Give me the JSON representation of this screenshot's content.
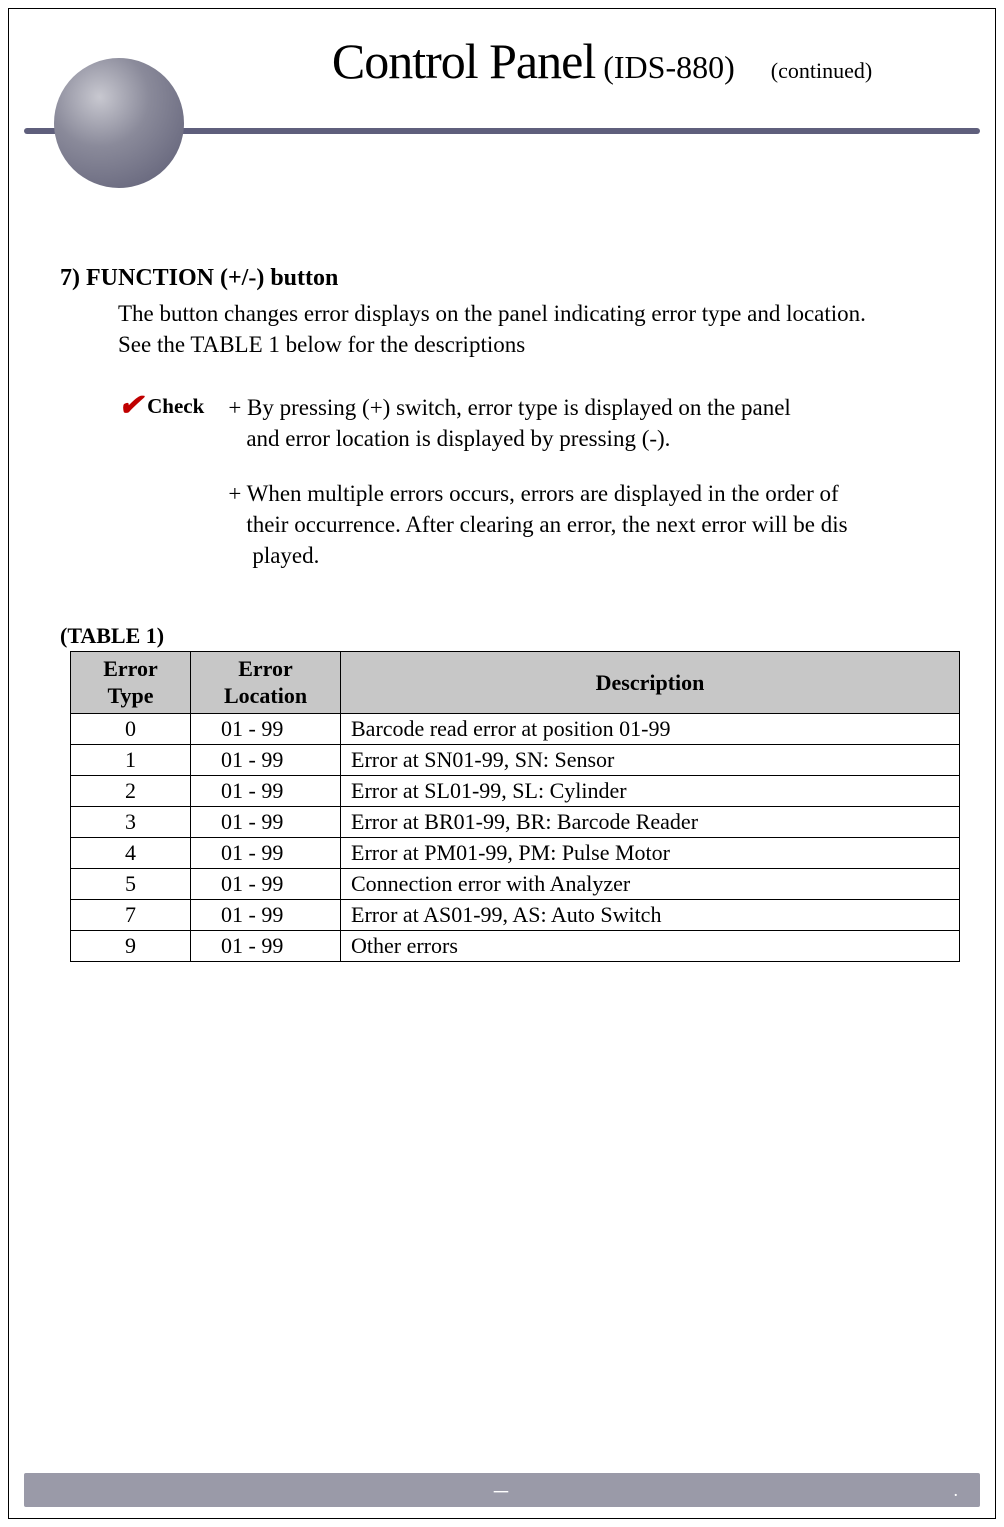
{
  "header": {
    "title_main": "Control Panel",
    "title_sub": " (IDS-880)",
    "continued": "(continued)"
  },
  "section": {
    "heading": "7) FUNCTION (+/-) button",
    "para_line1": "The button changes error displays on the panel indicating error type and location.",
    "para_line2": "See the TABLE 1 below for the descriptions",
    "check_label": "Check",
    "check1_l1": "+ By pressing (+) switch, error type is displayed on the panel",
    "check1_l2": "and error location is displayed by pressing (-).",
    "check2_l1": "+ When multiple errors occurs, errors are displayed in the order of",
    "check2_l2": "their occurrence. After clearing an error, the next error will be dis",
    "check2_l3": "played."
  },
  "table": {
    "label": "(TABLE 1)",
    "headers": {
      "type": "Error Type",
      "location": "Error Location",
      "description": "Description"
    },
    "rows": [
      {
        "type": "0",
        "loc": "01 - 99",
        "desc": "Barcode read error at position 01-99"
      },
      {
        "type": "1",
        "loc": "01 - 99",
        "desc": "Error at SN01-99, SN: Sensor"
      },
      {
        "type": "2",
        "loc": "01 - 99",
        "desc": "Error at SL01-99, SL: Cylinder"
      },
      {
        "type": "3",
        "loc": "01 - 99",
        "desc": "Error at BR01-99, BR: Barcode Reader"
      },
      {
        "type": "4",
        "loc": "01 - 99",
        "desc": "Error at PM01-99, PM: Pulse Motor"
      },
      {
        "type": "5",
        "loc": "01 - 99",
        "desc": "Connection error with Analyzer"
      },
      {
        "type": "7",
        "loc": "01 - 99",
        "desc": "Error at AS01-99, AS: Auto Switch"
      },
      {
        "type": "9",
        "loc": "01 - 99",
        "desc": "Other errors"
      }
    ]
  },
  "footer": {
    "page": "－",
    "right": "."
  }
}
